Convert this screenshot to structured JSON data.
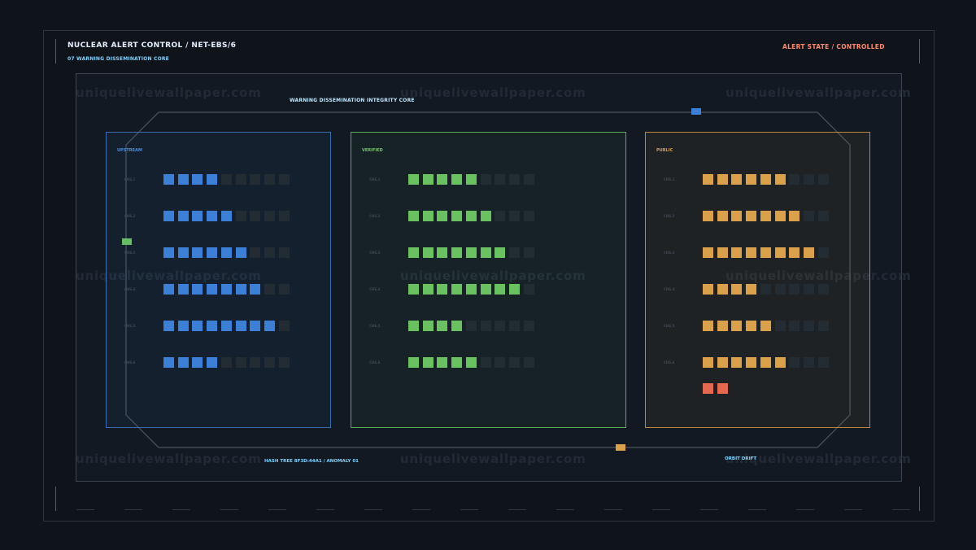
{
  "header": {
    "title": "NUCLEAR ALERT CONTROL / NET-EBS/6",
    "subtitle": "07  WARNING DISSEMINATION CORE",
    "alert_state": "ALERT STATE / CONTROLLED"
  },
  "core": {
    "title": "WARNING DISSEMINATION INTEGRITY CORE",
    "hash": "HASH TREE 8F3D:44A1 / ANOMALY 01",
    "drift_label": "ORBIT DRIFT"
  },
  "watermark": "uniquelivewallpaper.com",
  "colors": {
    "upstream": "#3b7fd6",
    "verified": "#69c25f",
    "public": "#dba04a",
    "anomaly": "#e6684e",
    "empty": "#232b33"
  },
  "columns": [
    {
      "key": "upstream",
      "label": "UPSTREAM",
      "rows": [
        {
          "label": "CHS.1",
          "filled": 4
        },
        {
          "label": "CHS.2",
          "filled": 5
        },
        {
          "label": "CHS.3",
          "filled": 6
        },
        {
          "label": "CHS.4",
          "filled": 7
        },
        {
          "label": "CHS.5",
          "filled": 8
        },
        {
          "label": "CHS.6",
          "filled": 4
        }
      ],
      "total": 9
    },
    {
      "key": "verified",
      "label": "VERIFIED",
      "rows": [
        {
          "label": "CHS.1",
          "filled": 5
        },
        {
          "label": "CHS.2",
          "filled": 6
        },
        {
          "label": "CHS.3",
          "filled": 7
        },
        {
          "label": "CHS.4",
          "filled": 8
        },
        {
          "label": "CHS.5",
          "filled": 4
        },
        {
          "label": "CHS.6",
          "filled": 5
        }
      ],
      "total": 9
    },
    {
      "key": "public",
      "label": "PUBLIC",
      "rows": [
        {
          "label": "CHS.1",
          "filled": 6
        },
        {
          "label": "CHS.2",
          "filled": 7
        },
        {
          "label": "CHS.3",
          "filled": 8
        },
        {
          "label": "CHS.4",
          "filled": 4
        },
        {
          "label": "CHS.5",
          "filled": 5
        },
        {
          "label": "CHS.6",
          "filled": 6
        }
      ],
      "total": 9,
      "anomaly_cells": 2
    }
  ]
}
